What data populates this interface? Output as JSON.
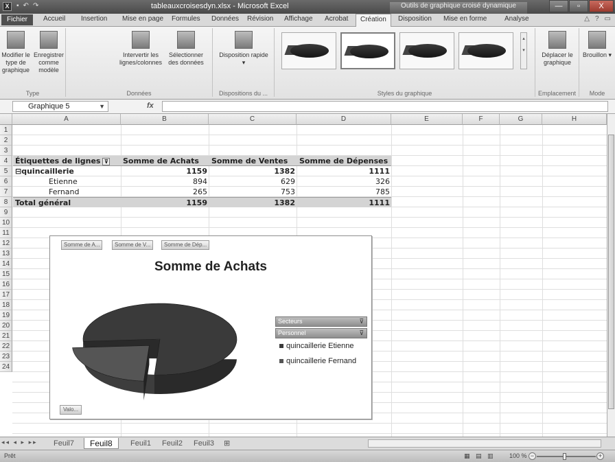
{
  "window": {
    "title": "tableauxcroisesdyn.xlsx - Microsoft Excel",
    "context_title": "Outils de graphique croisé dynamique",
    "app_icon": "X",
    "qat": [
      "save-icon",
      "undo-icon",
      "redo-icon"
    ],
    "controls": [
      "—",
      "▫",
      "X"
    ]
  },
  "ribbon_tabs": {
    "file": "Fichier",
    "items": [
      "Accueil",
      "Insertion",
      "Mise en page",
      "Formules",
      "Données",
      "Révision",
      "Affichage",
      "Acrobat",
      "Création",
      "Disposition",
      "Mise en forme",
      "Analyse"
    ],
    "active": "Création"
  },
  "ribbon": {
    "groups": [
      {
        "label": "Type",
        "buttons": [
          "Modifier le type de graphique",
          "Enregistrer comme modèle"
        ]
      },
      {
        "label": "Données",
        "buttons": [
          "Intervertir les lignes/colonnes",
          "Sélectionner des données"
        ]
      },
      {
        "label": "Dispositions du ...",
        "buttons": [
          "Disposition rapide ▾"
        ]
      },
      {
        "label": "Styles du graphique",
        "buttons": []
      },
      {
        "label": "Emplacement",
        "buttons": [
          "Déplacer le graphique"
        ]
      },
      {
        "label": "Mode",
        "buttons": [
          "Brouillon ▾"
        ]
      }
    ]
  },
  "formula_bar": {
    "name_box": "Graphique 5",
    "fx": "fx",
    "value": ""
  },
  "columns": [
    "A",
    "B",
    "C",
    "D",
    "E",
    "F",
    "G",
    "H"
  ],
  "rows": [
    "1",
    "2",
    "3",
    "4",
    "5",
    "6",
    "7",
    "8",
    "9",
    "10",
    "11",
    "12",
    "13",
    "14",
    "15",
    "16",
    "17",
    "18",
    "19",
    "20",
    "21",
    "22",
    "23",
    "24"
  ],
  "pivot": {
    "headers": [
      "Étiquettes de lignes",
      "Somme de Achats",
      "Somme de Ventes",
      "Somme de Dépenses"
    ],
    "group": {
      "label": "⊟quincaillerie",
      "values": [
        "1159",
        "1382",
        "1111"
      ]
    },
    "rows": [
      {
        "label": "Etienne",
        "values": [
          "894",
          "629",
          "326"
        ]
      },
      {
        "label": "Fernand",
        "values": [
          "265",
          "753",
          "785"
        ]
      }
    ],
    "total": {
      "label": "Total général",
      "values": [
        "1159",
        "1382",
        "1111"
      ]
    }
  },
  "chart": {
    "field_buttons": [
      "Somme de A...",
      "Somme de V...",
      "Somme de Dép..."
    ],
    "title": "Somme de Achats",
    "legend_fields": [
      "Secteurs",
      "Personnel"
    ],
    "legend_entries": [
      "quincaillerie Etienne",
      "quincaillerie Fernand"
    ],
    "value_button": "Valo...",
    "slice_colors": [
      "#3a3a3a",
      "#555555"
    ]
  },
  "chart_data": {
    "type": "pie",
    "title": "Somme de Achats",
    "categories": [
      "quincaillerie Etienne",
      "quincaillerie Fernand"
    ],
    "values": [
      894,
      265
    ]
  },
  "sheets": {
    "nav": "◂◂ ◂ ▸ ▸▸",
    "tabs": [
      "Feuil7",
      "Feuil8",
      "Feuil1",
      "Feuil2",
      "Feuil3"
    ],
    "active": "Feuil8",
    "insert_icon": "⊞"
  },
  "status": {
    "ready": "Prêt",
    "zoom": "100 %",
    "views": "▦ ▤ ▥"
  }
}
